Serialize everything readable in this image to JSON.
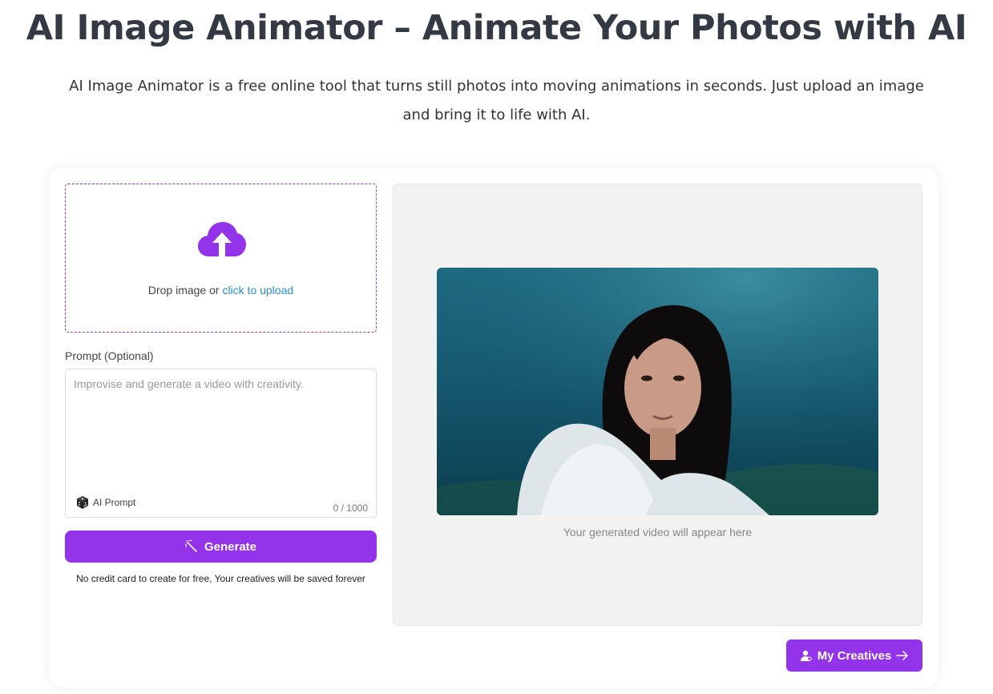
{
  "header": {
    "title": "AI Image Animator – Animate Your Photos with AI",
    "subtitle": "AI Image Animator is a free online tool that turns still photos into moving animations in seconds. Just upload an image and bring it to life with AI."
  },
  "upload": {
    "icon": "cloud-upload-icon",
    "text_prefix": "Drop image or ",
    "link_text": "click to upload"
  },
  "prompt": {
    "label": "Prompt (Optional)",
    "placeholder": "Improvise and generate a video with creativity.",
    "value": "",
    "ai_prompt_label": "AI Prompt",
    "ai_prompt_icon": "dice-icon",
    "char_count": "0 / 1000"
  },
  "generate": {
    "label": "Generate",
    "icon": "magic-wand-icon",
    "note": "No credit card to create for free, Your creatives will be saved forever"
  },
  "preview": {
    "caption": "Your generated video will appear here"
  },
  "my_creatives": {
    "label": "My Creatives",
    "icon": "user-icon",
    "arrow_icon": "arrow-right-icon"
  },
  "colors": {
    "accent": "#9333ea",
    "link": "#2b8ce0",
    "dashed_border": "#a03dbd",
    "title": "#333a44"
  }
}
